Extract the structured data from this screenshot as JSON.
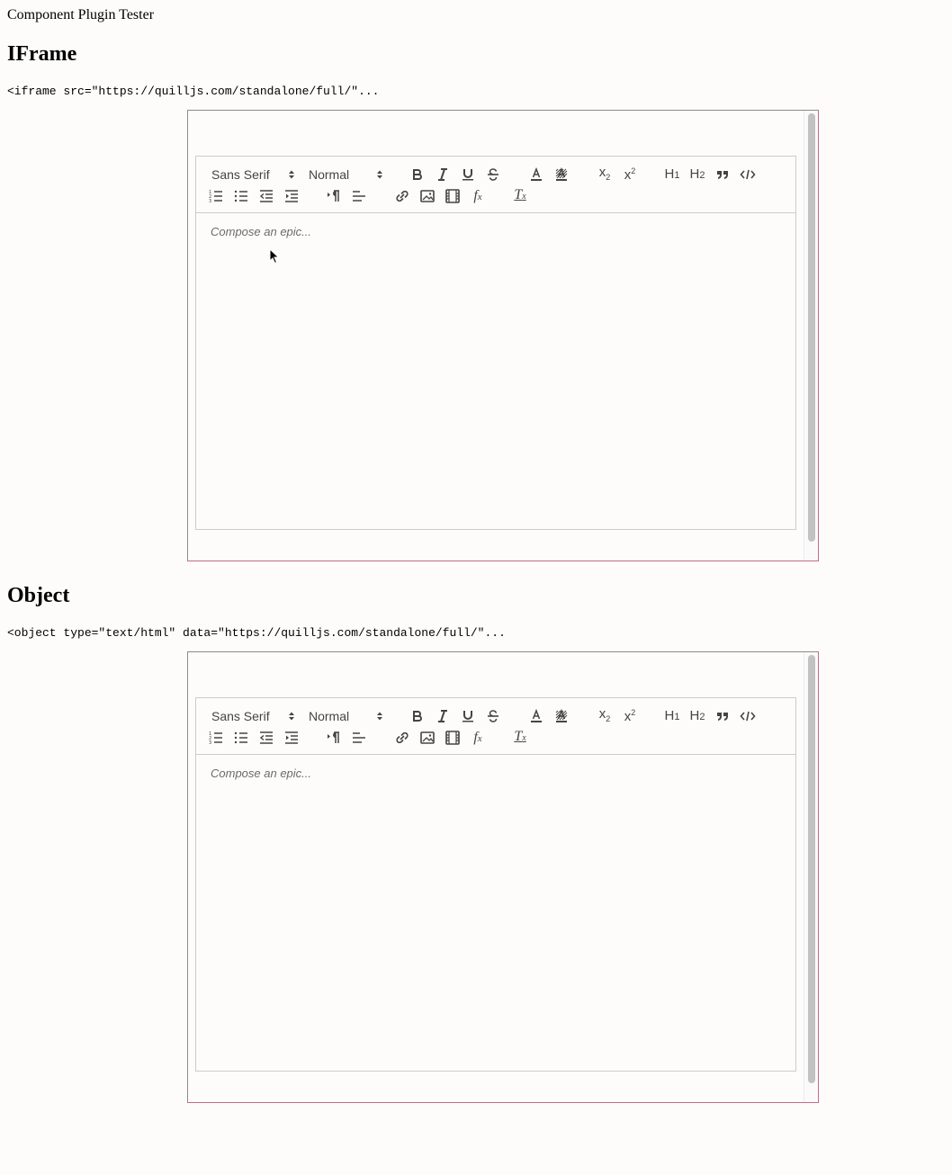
{
  "page": {
    "title": "Component Plugin Tester"
  },
  "sections": [
    {
      "heading": "IFrame",
      "code": "<iframe src=\"https://quilljs.com/standalone/full/\"...",
      "editor": {
        "font_picker": "Sans Serif",
        "size_picker": "Normal",
        "placeholder": "Compose an epic..."
      }
    },
    {
      "heading": "Object",
      "code": "<object type=\"text/html\" data=\"https://quilljs.com/standalone/full/\"...",
      "editor": {
        "font_picker": "Sans Serif",
        "size_picker": "Normal",
        "placeholder": "Compose an epic..."
      }
    }
  ],
  "toolbar_icons": [
    "bold-icon",
    "italic-icon",
    "underline-icon",
    "strike-icon",
    "text-color-icon",
    "background-color-icon",
    "subscript-icon",
    "superscript-icon",
    "header-1-icon",
    "header-2-icon",
    "blockquote-icon",
    "code-block-icon",
    "ordered-list-icon",
    "bullet-list-icon",
    "outdent-icon",
    "indent-icon",
    "direction-icon",
    "align-icon",
    "link-icon",
    "image-icon",
    "video-icon",
    "formula-icon",
    "clean-icon"
  ],
  "colors": {
    "frame_border": "#8b8b8b",
    "frame_border_accent": "#c46a8a",
    "toolbar_icon": "#444444",
    "placeholder": "#6b6b6b"
  }
}
